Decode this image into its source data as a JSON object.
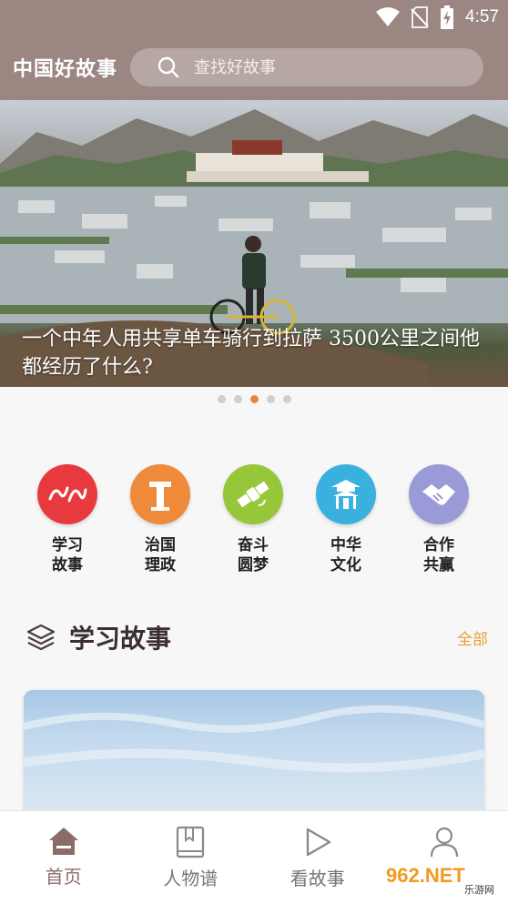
{
  "status_bar": {
    "time": "4:57",
    "icons": [
      "wifi-icon",
      "no-sim-icon",
      "battery-charging-icon"
    ]
  },
  "header": {
    "brand": "中国好故事",
    "search": {
      "placeholder": "查找好故事",
      "value": "",
      "icon": "search-icon"
    },
    "background": "#9b8682"
  },
  "banner": {
    "caption": "一个中年人用共享单车骑行到拉萨 3500公里之间他都经历了什么?",
    "slide_count": 5,
    "active_slide": 3
  },
  "categories": [
    {
      "label": "学习故事",
      "icon": "study-calligraphy-icon",
      "color": "#e83a3e"
    },
    {
      "label": "治国理政",
      "icon": "monument-icon",
      "color": "#ee8a3a"
    },
    {
      "label": "奋斗圆梦",
      "icon": "satellite-icon",
      "color": "#96c73a"
    },
    {
      "label": "中华文化",
      "icon": "pavilion-icon",
      "color": "#3ab0df"
    },
    {
      "label": "合作共赢",
      "icon": "handshake-icon",
      "color": "#9a9ad8"
    }
  ],
  "section": {
    "title": "学习故事",
    "more": "全部",
    "icon": "layers-icon"
  },
  "nav": [
    {
      "label": "首页",
      "icon": "home-icon",
      "active": true
    },
    {
      "label": "人物谱",
      "icon": "book-icon",
      "active": false
    },
    {
      "label": "看故事",
      "icon": "play-icon",
      "active": false
    },
    {
      "label": "",
      "icon": "user-icon",
      "active": false
    }
  ],
  "watermark": {
    "text": "962.NET",
    "subtext": "乐游网"
  },
  "colors": {
    "accent": "#e8843e",
    "more": "#e5a03a",
    "nav_active": "#8a6d68"
  }
}
